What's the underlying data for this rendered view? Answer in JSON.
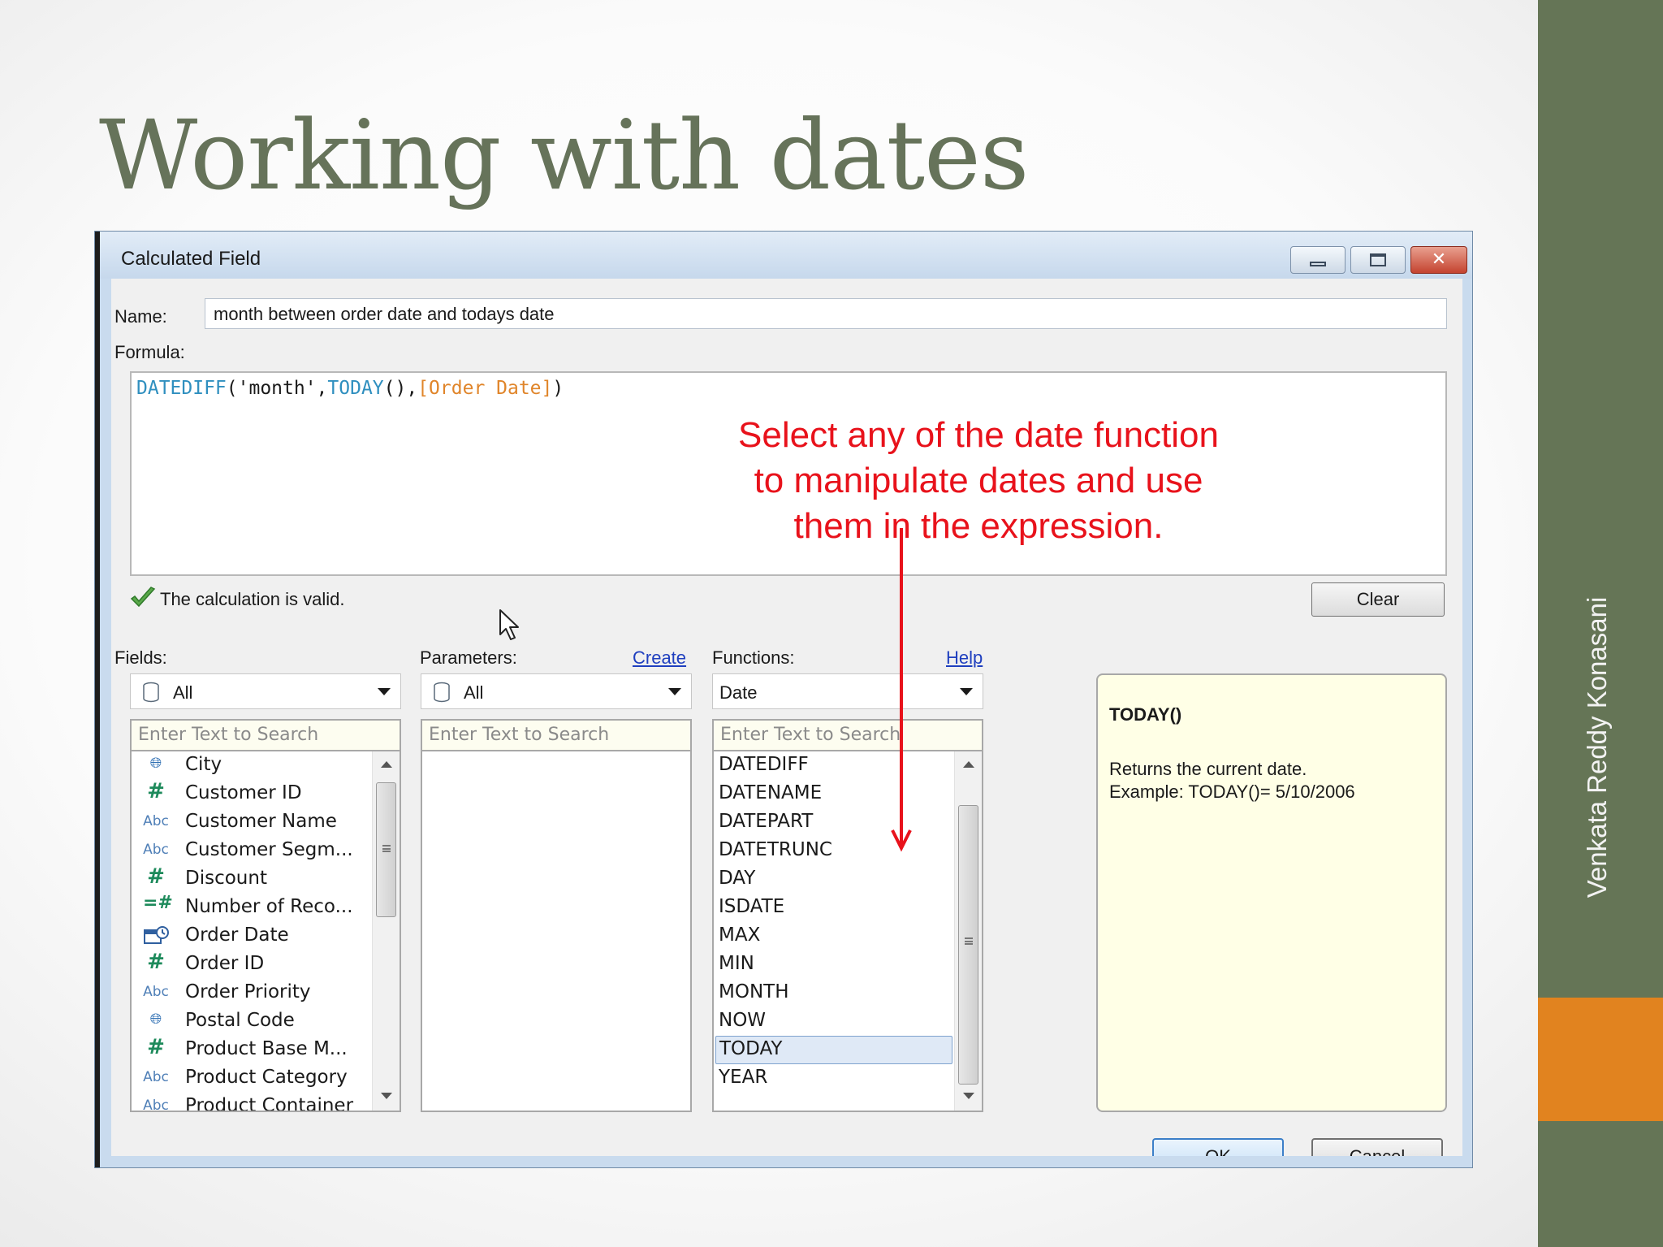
{
  "slide": {
    "title": "Working with dates",
    "author": "Venkata Reddy Konasani"
  },
  "dialog": {
    "title": "Calculated Field",
    "name_label": "Name:",
    "name_value": "month between order date and todays date",
    "formula_label": "Formula:",
    "formula": {
      "fn1": "DATEDIFF",
      "arg1": "('month',",
      "fn2": "TODAY",
      "arg2": "(),",
      "field": "[Order Date]",
      "close": ")"
    },
    "status": "The calculation is valid.",
    "clear_label": "Clear",
    "fields": {
      "label": "Fields:",
      "filter": "All",
      "search_placeholder": "Enter Text to Search",
      "items": [
        {
          "icon": "geo",
          "label": "City"
        },
        {
          "icon": "hash",
          "label": "Customer ID"
        },
        {
          "icon": "abc",
          "label": "Customer Name"
        },
        {
          "icon": "abc",
          "label": "Customer Segm..."
        },
        {
          "icon": "hash",
          "label": "Discount"
        },
        {
          "icon": "calc-hash",
          "label": "Number of Reco..."
        },
        {
          "icon": "date",
          "label": "Order Date"
        },
        {
          "icon": "hash",
          "label": "Order ID"
        },
        {
          "icon": "abc",
          "label": "Order Priority"
        },
        {
          "icon": "geo",
          "label": "Postal Code"
        },
        {
          "icon": "hash",
          "label": "Product Base M..."
        },
        {
          "icon": "abc",
          "label": "Product Category"
        },
        {
          "icon": "abc",
          "label": "Product Container"
        }
      ]
    },
    "parameters": {
      "label": "Parameters:",
      "create_link": "Create",
      "filter": "All",
      "search_placeholder": "Enter Text to Search"
    },
    "functions": {
      "label": "Functions:",
      "help_link": "Help",
      "filter": "Date",
      "search_placeholder": "Enter Text to Search",
      "items": [
        "DATEDIFF",
        "DATENAME",
        "DATEPART",
        "DATETRUNC",
        "DAY",
        "ISDATE",
        "MAX",
        "MIN",
        "MONTH",
        "NOW",
        "TODAY",
        "YEAR"
      ],
      "selected": "TODAY"
    },
    "description": {
      "title": "TODAY()",
      "line1": "Returns the current date.",
      "line2": "Example: TODAY()= 5/10/2006"
    },
    "ok_label": "OK",
    "cancel_label": "Cancel"
  },
  "annotation": {
    "line1": "Select any of the date function",
    "line2": "to manipulate dates and use",
    "line3": "them in the expression.",
    "color": "#e8121b"
  },
  "colors": {
    "title": "#66735a",
    "sidebar": "#657556",
    "accent": "#e1831f"
  }
}
